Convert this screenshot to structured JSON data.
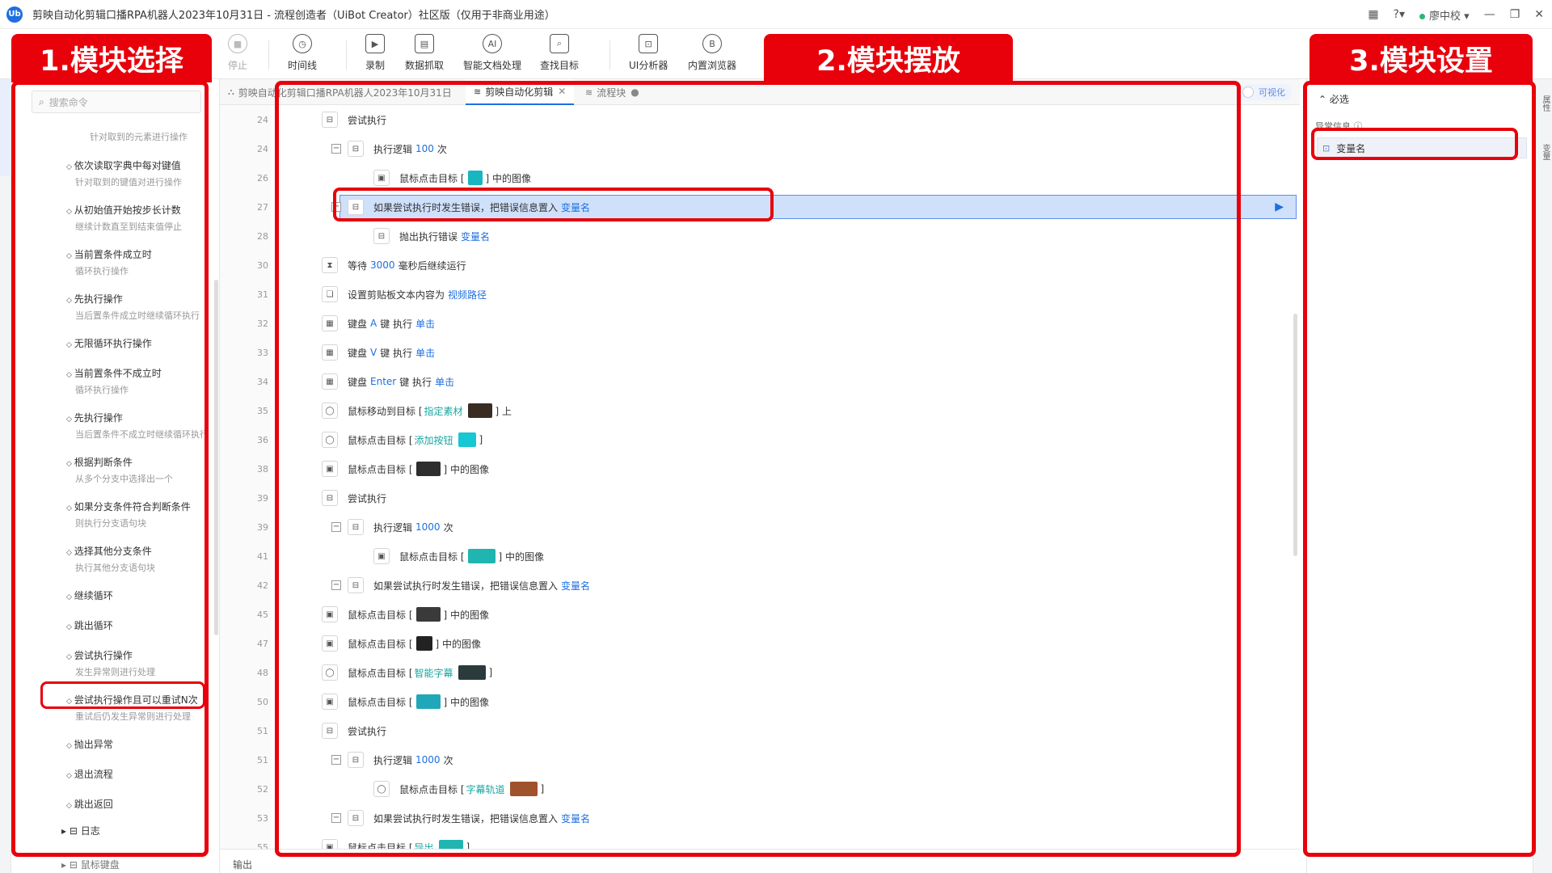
{
  "titlebar": {
    "title": "剪映自动化剪辑口播RPA机器人2023年10月31日 - 流程创造者（UiBot Creator）社区版（仅用于非商业用途）",
    "logo": "Ub",
    "user": "廖中校",
    "icons": [
      "apps-icon",
      "help-icon",
      "minimize-icon",
      "restore-icon",
      "close-icon"
    ]
  },
  "toolbar": {
    "stop": "停止",
    "timeline": "时间线",
    "record": "录制",
    "data_capture": "数据抓取",
    "smart_doc": "智能文档处理",
    "find_target": "查找目标",
    "ui_analyzer": "UI分析器",
    "builtin_browser": "内置浏览器"
  },
  "callouts": {
    "c1": "1.模块选择",
    "c2": "2.模块摆放",
    "c3": "3.模块设置"
  },
  "left": {
    "search_placeholder": "搜索命令",
    "first_desc": "针对取到的元素进行操作",
    "items": [
      {
        "title": "依次读取字典中每对键值",
        "desc": "针对取到的键值对进行操作"
      },
      {
        "title": "从初始值开始按步长计数",
        "desc": "继续计数直至到结束值停止"
      },
      {
        "title": "当前置条件成立时",
        "desc": "循环执行操作"
      },
      {
        "title": "先执行操作",
        "desc": "当后置条件成立时继续循环执行"
      },
      {
        "title": "无限循环执行操作",
        "desc": ""
      },
      {
        "title": "当前置条件不成立时",
        "desc": "循环执行操作"
      },
      {
        "title": "先执行操作",
        "desc": "当后置条件不成立时继续循环执行"
      },
      {
        "title": "根据判断条件",
        "desc": "从多个分支中选择出一个"
      },
      {
        "title": "如果分支条件符合判断条件",
        "desc": "则执行分支语句块"
      },
      {
        "title": "选择其他分支条件",
        "desc": "执行其他分支语句块"
      },
      {
        "title": "继续循环",
        "desc": ""
      },
      {
        "title": "跳出循环",
        "desc": ""
      },
      {
        "title": "尝试执行操作",
        "desc": "发生异常则进行处理"
      },
      {
        "title": "尝试执行操作且可以重试N次",
        "desc": "重试后仍发生异常则进行处理"
      },
      {
        "title": "抛出异常",
        "desc": ""
      },
      {
        "title": "退出流程",
        "desc": ""
      },
      {
        "title": "跳出返回",
        "desc": ""
      }
    ],
    "log": "日志",
    "bottom": "鼠标键盘"
  },
  "tabs": [
    {
      "label": "剪映自动化剪辑口播RPA机器人2023年10月31日"
    },
    {
      "label": "剪映自动化剪辑"
    },
    {
      "label": "流程块"
    }
  ],
  "visualize": "可视化",
  "rows": [
    {
      "ln": "24",
      "indent": 0,
      "fold": false,
      "icon": "try-icon",
      "parts": [
        {
          "t": "尝试执行"
        }
      ]
    },
    {
      "ln": "24",
      "indent": 1,
      "fold": true,
      "icon": "try-icon",
      "parts": [
        {
          "t": "执行逻辑"
        },
        {
          "k": "100"
        },
        {
          "t": "次"
        }
      ]
    },
    {
      "ln": "26",
      "indent": 2,
      "fold": false,
      "icon": "image-icon",
      "parts": [
        {
          "t": "鼠标点击目标 ["
        },
        {
          "img": "#17b6c0",
          "w": 18
        },
        {
          "t": "] 中的图像"
        }
      ]
    },
    {
      "ln": "27",
      "indent": 1,
      "fold": true,
      "icon": "try-icon",
      "selected": true,
      "parts": [
        {
          "t": "如果尝试执行时发生错误，把错误信息置入"
        },
        {
          "k": "变量名"
        }
      ]
    },
    {
      "ln": "28",
      "indent": 2,
      "fold": false,
      "icon": "try-icon",
      "parts": [
        {
          "t": "抛出执行错误"
        },
        {
          "k": "变量名"
        }
      ]
    },
    {
      "ln": "30",
      "indent": 0,
      "fold": false,
      "icon": "wait-icon",
      "parts": [
        {
          "t": "等待"
        },
        {
          "k": "3000"
        },
        {
          "t": "毫秒后继续运行"
        }
      ]
    },
    {
      "ln": "31",
      "indent": 0,
      "fold": false,
      "icon": "clipboard-icon",
      "parts": [
        {
          "t": "设置剪贴板文本内容为"
        },
        {
          "k": "视频路径"
        }
      ]
    },
    {
      "ln": "32",
      "indent": 0,
      "fold": false,
      "icon": "keyboard-icon",
      "parts": [
        {
          "t": "键盘"
        },
        {
          "k": "A"
        },
        {
          "t": "键 执行"
        },
        {
          "k": "单击"
        }
      ]
    },
    {
      "ln": "33",
      "indent": 0,
      "fold": false,
      "icon": "keyboard-icon",
      "parts": [
        {
          "t": "键盘"
        },
        {
          "k": "V"
        },
        {
          "t": "键 执行"
        },
        {
          "k": "单击"
        }
      ]
    },
    {
      "ln": "34",
      "indent": 0,
      "fold": false,
      "icon": "keyboard-icon",
      "parts": [
        {
          "t": "键盘"
        },
        {
          "k": "Enter"
        },
        {
          "t": "键 执行"
        },
        {
          "k": "单击"
        }
      ]
    },
    {
      "ln": "35",
      "indent": 0,
      "fold": false,
      "icon": "mouse-icon",
      "parts": [
        {
          "t": "鼠标移动到目标 ["
        },
        {
          "g": "指定素材"
        },
        {
          "img": "#3a2c20",
          "w": 30
        },
        {
          "t": "] 上"
        }
      ]
    },
    {
      "ln": "36",
      "indent": 0,
      "fold": false,
      "icon": "mouse-icon",
      "parts": [
        {
          "t": "鼠标点击目标 ["
        },
        {
          "g": "添加按钮"
        },
        {
          "img": "#17c7d2",
          "w": 22
        },
        {
          "t": "]"
        }
      ]
    },
    {
      "ln": "38",
      "indent": 0,
      "fold": false,
      "icon": "image-icon",
      "parts": [
        {
          "t": "鼠标点击目标 ["
        },
        {
          "img": "#2e2e2e",
          "w": 30
        },
        {
          "t": "] 中的图像"
        }
      ]
    },
    {
      "ln": "39",
      "indent": 0,
      "fold": false,
      "icon": "try-icon",
      "parts": [
        {
          "t": "尝试执行"
        }
      ]
    },
    {
      "ln": "39",
      "indent": 1,
      "fold": true,
      "icon": "try-icon",
      "parts": [
        {
          "t": "执行逻辑"
        },
        {
          "k": "1000"
        },
        {
          "t": "次"
        }
      ]
    },
    {
      "ln": "41",
      "indent": 2,
      "fold": false,
      "icon": "image-icon",
      "parts": [
        {
          "t": "鼠标点击目标 ["
        },
        {
          "img": "#20b5b0",
          "w": 34
        },
        {
          "t": "] 中的图像"
        }
      ]
    },
    {
      "ln": "42",
      "indent": 1,
      "fold": true,
      "icon": "try-icon",
      "parts": [
        {
          "t": "如果尝试执行时发生错误，把错误信息置入"
        },
        {
          "k": "变量名"
        }
      ]
    },
    {
      "ln": "45",
      "indent": 0,
      "fold": false,
      "icon": "image-icon",
      "parts": [
        {
          "t": "鼠标点击目标 ["
        },
        {
          "img": "#3a3a3a",
          "w": 30
        },
        {
          "t": "] 中的图像"
        }
      ]
    },
    {
      "ln": "47",
      "indent": 0,
      "fold": false,
      "icon": "image-icon",
      "parts": [
        {
          "t": "鼠标点击目标 ["
        },
        {
          "img": "#222222",
          "w": 20
        },
        {
          "t": "] 中的图像"
        }
      ]
    },
    {
      "ln": "48",
      "indent": 0,
      "fold": false,
      "icon": "mouse-icon",
      "parts": [
        {
          "t": "鼠标点击目标 ["
        },
        {
          "g": "智能字幕"
        },
        {
          "img": "#2b3b3b",
          "w": 34
        },
        {
          "t": "]"
        }
      ]
    },
    {
      "ln": "50",
      "indent": 0,
      "fold": false,
      "icon": "image-icon",
      "parts": [
        {
          "t": "鼠标点击目标 ["
        },
        {
          "img": "#20a8b8",
          "w": 30
        },
        {
          "t": "] 中的图像"
        }
      ]
    },
    {
      "ln": "51",
      "indent": 0,
      "fold": false,
      "icon": "try-icon",
      "parts": [
        {
          "t": "尝试执行"
        }
      ]
    },
    {
      "ln": "51",
      "indent": 1,
      "fold": true,
      "icon": "try-icon",
      "parts": [
        {
          "t": "执行逻辑"
        },
        {
          "k": "1000"
        },
        {
          "t": "次"
        }
      ]
    },
    {
      "ln": "52",
      "indent": 2,
      "fold": false,
      "icon": "mouse-icon",
      "parts": [
        {
          "t": "鼠标点击目标 ["
        },
        {
          "g": "字幕轨道"
        },
        {
          "img": "#a0522d",
          "w": 34
        },
        {
          "t": "]"
        }
      ]
    },
    {
      "ln": "53",
      "indent": 1,
      "fold": true,
      "icon": "try-icon",
      "parts": [
        {
          "t": "如果尝试执行时发生错误，把错误信息置入"
        },
        {
          "k": "变量名"
        }
      ]
    },
    {
      "ln": "55",
      "indent": 0,
      "fold": false,
      "icon": "image-icon",
      "parts": [
        {
          "t": "鼠标点击目标 ["
        },
        {
          "g": "导出"
        },
        {
          "img": "#20b5b0",
          "w": 30
        },
        {
          "t": "]"
        }
      ]
    }
  ],
  "output": "输出",
  "right": {
    "required": "必选",
    "error_info": "异常信息",
    "var_name": "变量名",
    "strip_tabs": [
      "属性",
      "变量"
    ]
  }
}
